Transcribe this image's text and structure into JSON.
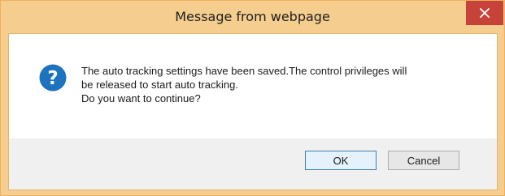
{
  "dialog": {
    "title": "Message from webpage",
    "close_glyph": "×",
    "icon": "question-icon",
    "message_lines": [
      "The auto tracking settings have been saved.The control privileges will",
      "be released to start auto tracking.",
      "Do you want to continue?"
    ],
    "ok_label": "OK",
    "cancel_label": "Cancel"
  },
  "colors": {
    "frame": "#f4cd8f",
    "close_button": "#c7433a",
    "icon": "#1e73be",
    "footer": "#f0f0f0",
    "ok_border": "#3c7fb1"
  }
}
